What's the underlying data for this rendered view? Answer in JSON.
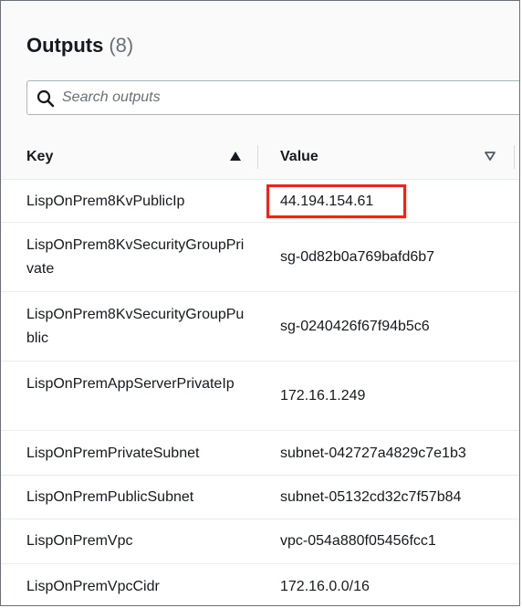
{
  "panel": {
    "title": "Outputs",
    "count": "(8)"
  },
  "search": {
    "placeholder": "Search outputs",
    "icon": "search-icon"
  },
  "table": {
    "columns": [
      {
        "label": "Key",
        "sort": "ascending"
      },
      {
        "label": "Value",
        "sort": "descending"
      }
    ],
    "rows": [
      {
        "key": "LispOnPrem8KvPublicIp",
        "value": "44.194.154.61",
        "highlighted": true
      },
      {
        "key": "LispOnPrem8KvSecurityGroupPrivate",
        "value": "sg-0d82b0a769bafd6b7"
      },
      {
        "key": "LispOnPrem8KvSecurityGroupPublic",
        "value": "sg-0240426f67f94b5c6"
      },
      {
        "key": "LispOnPremAppServerPrivateIp",
        "value": "172.16.1.249"
      },
      {
        "key": "LispOnPremPrivateSubnet",
        "value": "subnet-042727a4829c7e1b3"
      },
      {
        "key": "LispOnPremPublicSubnet",
        "value": "subnet-05132cd32c7f57b84"
      },
      {
        "key": "LispOnPremVpc",
        "value": "vpc-054a880f05456fcc1"
      },
      {
        "key": "LispOnPremVpcCidr",
        "value": "172.16.0.0/16"
      }
    ]
  },
  "colors": {
    "highlight_border": "#e8281e",
    "header_bg": "#fafafa"
  }
}
